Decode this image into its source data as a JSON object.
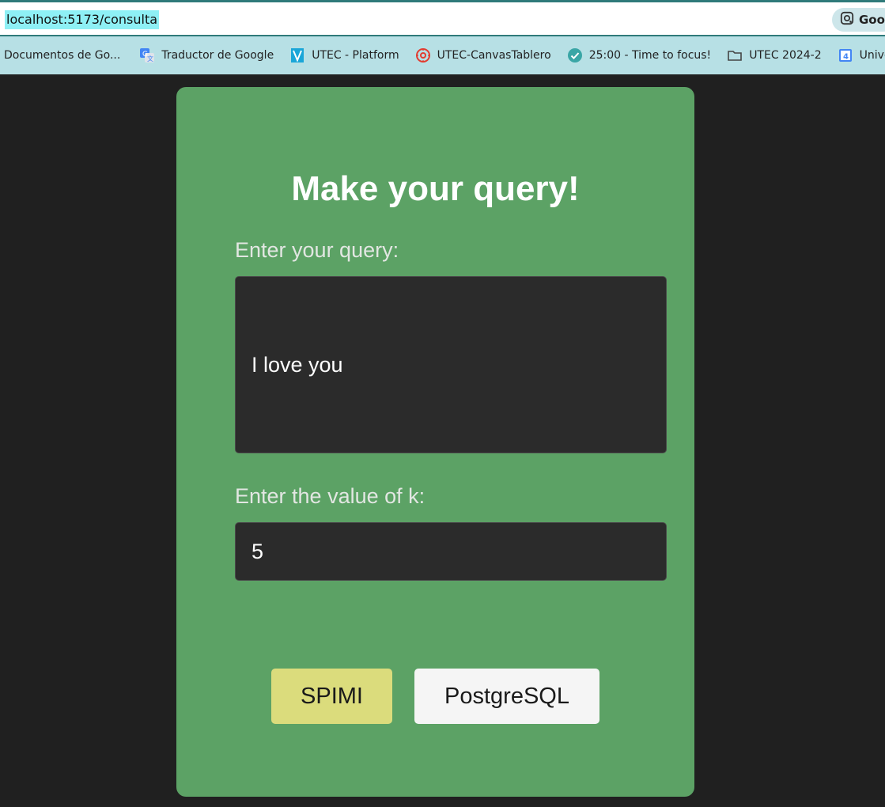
{
  "browser": {
    "url": "localhost:5173/consulta",
    "lens_label": "Goo",
    "bookmarks": [
      {
        "label": "Documentos de Go...",
        "icon": "none"
      },
      {
        "label": "Traductor de Google",
        "icon": "google-translate-icon"
      },
      {
        "label": "UTEC - Platform",
        "icon": "utec-icon"
      },
      {
        "label": "UTEC-CanvasTablero",
        "icon": "canvas-icon"
      },
      {
        "label": "25:00 - Time to focus!",
        "icon": "check-circle-icon"
      },
      {
        "label": "UTEC 2024-2",
        "icon": "folder-icon"
      },
      {
        "label": "Universidad",
        "icon": "calendar-icon"
      }
    ]
  },
  "card": {
    "title": "Make your query!",
    "query_label": "Enter your query:",
    "query_value": "I love you",
    "k_label": "Enter the value of k:",
    "k_value": "5",
    "buttons": {
      "spimi": "SPIMI",
      "postgres": "PostgreSQL"
    }
  },
  "colors": {
    "page_background": "#202020",
    "card_background": "#5ca265",
    "input_background": "#2b2b2b",
    "spimi_button": "#dbdc7c",
    "postgres_button": "#f5f5f5",
    "bookmarks_bar": "#b7e0e5"
  }
}
